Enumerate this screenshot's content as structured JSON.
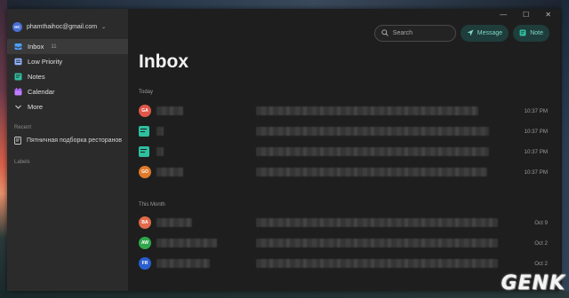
{
  "account": {
    "email": "phamthaihoc@gmail.com",
    "initials": "HC"
  },
  "sidebar": {
    "items": [
      {
        "label": "Inbox",
        "count": "11",
        "icon": "inbox-icon",
        "color": "#4ea1ff",
        "active": true
      },
      {
        "label": "Low Priority",
        "count": "",
        "icon": "low-priority-icon",
        "color": "#8fb2ff",
        "active": false
      },
      {
        "label": "Notes",
        "count": "",
        "icon": "notes-icon",
        "color": "#2ebf9f",
        "active": false
      },
      {
        "label": "Calendar",
        "count": "",
        "icon": "calendar-icon",
        "color": "#c07fff",
        "active": false
      },
      {
        "label": "More",
        "count": "",
        "icon": "chevron-down-icon",
        "color": "#cfcfcf",
        "active": false
      }
    ],
    "recent_label": "Recent",
    "recent_items": [
      {
        "label": "Пятничная подборка ресторанов",
        "icon": "note-doc-icon"
      }
    ],
    "labels_label": "Labels"
  },
  "toolbar": {
    "search_placeholder": "Search",
    "message_label": "Message",
    "note_label": "Note"
  },
  "main": {
    "title": "Inbox",
    "groups": [
      {
        "label": "Today",
        "rows": [
          {
            "avatar": "GA",
            "avatar_color": "#e0574a",
            "time": "10:37 PM",
            "type": "person"
          },
          {
            "avatar": "",
            "avatar_color": "#2ebf9f",
            "time": "10:37 PM",
            "type": "note"
          },
          {
            "avatar": "",
            "avatar_color": "#2ebf9f",
            "time": "10:37 PM",
            "type": "note"
          },
          {
            "avatar": "GO",
            "avatar_color": "#e07a2a",
            "time": "10:37 PM",
            "type": "person"
          }
        ]
      },
      {
        "label": "This Month",
        "rows": [
          {
            "avatar": "BA",
            "avatar_color": "#e06a4a",
            "time": "Oct 9",
            "type": "person"
          },
          {
            "avatar": "AW",
            "avatar_color": "#2fa84a",
            "time": "Oct 2",
            "type": "person"
          },
          {
            "avatar": "FR",
            "avatar_color": "#2a5ecf",
            "time": "Oct 2",
            "type": "person"
          }
        ]
      }
    ]
  },
  "window_controls": {
    "minimize": "—",
    "maximize": "☐",
    "close": "✕"
  },
  "watermark": "GENK"
}
